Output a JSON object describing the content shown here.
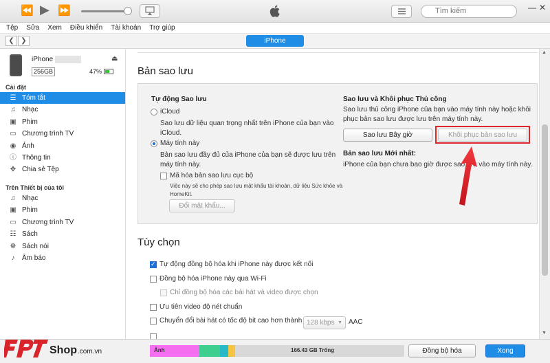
{
  "toolbar": {
    "prev_icon": "rewind-icon",
    "play_icon": "play-icon",
    "next_icon": "fast-forward-icon",
    "search_placeholder": "Tìm kiếm"
  },
  "menu": [
    "Tệp",
    "Sửa",
    "Xem",
    "Điều khiển",
    "Tài khoản",
    "Trợ giúp"
  ],
  "nav": {
    "device_tab": "iPhone"
  },
  "device": {
    "name": "iPhone",
    "capacity": "256GB",
    "battery": "47%",
    "battery_level": 0.47
  },
  "sidebar": {
    "settings_heading": "Cài đặt",
    "settings_items": [
      {
        "label": "Tóm tắt",
        "icon": "list-icon",
        "selected": true
      },
      {
        "label": "Nhạc",
        "icon": "music-note-icon"
      },
      {
        "label": "Phim",
        "icon": "film-icon"
      },
      {
        "label": "Chương trình TV",
        "icon": "tv-icon"
      },
      {
        "label": "Ảnh",
        "icon": "camera-icon"
      },
      {
        "label": "Thông tin",
        "icon": "info-icon"
      },
      {
        "label": "Chia sẻ Tệp",
        "icon": "apps-icon"
      }
    ],
    "ondevice_heading": "Trên Thiết bị của tôi",
    "ondevice_items": [
      {
        "label": "Nhạc",
        "icon": "music-note-icon"
      },
      {
        "label": "Phim",
        "icon": "film-icon"
      },
      {
        "label": "Chương trình TV",
        "icon": "tv-icon"
      },
      {
        "label": "Sách",
        "icon": "book-icon"
      },
      {
        "label": "Sách nói",
        "icon": "audiobook-icon"
      },
      {
        "label": "Âm báo",
        "icon": "bell-icon"
      }
    ]
  },
  "backup": {
    "title": "Bản sao lưu",
    "auto_heading": "Tự động Sao lưu",
    "icloud_label": "iCloud",
    "icloud_desc_1": "Sao lưu dữ liệu quan trọng nhất trên iPhone của bạn vào",
    "icloud_desc_2": "iCloud.",
    "computer_label": "Máy tính này",
    "computer_desc_1": "Bản sao lưu đầy đủ của iPhone của bạn sẽ được lưu trên",
    "computer_desc_2": "máy tính này.",
    "encrypt_label": "Mã hóa bản sao lưu cục bộ",
    "encrypt_desc_1": "Việc này sẽ cho phép sao lưu mật khẩu tài khoản, dữ liệu Sức khỏe và",
    "encrypt_desc_2": "HomeKit.",
    "change_password_btn": "Đổi mật khẩu...",
    "manual_heading": "Sao lưu và Khôi phục Thủ công",
    "manual_desc_1": "Sao lưu thủ công iPhone của bạn vào máy tính này hoặc khôi",
    "manual_desc_2": "phục bản sao lưu được lưu trên máy tính này.",
    "backup_now_btn": "Sao lưu Bây giờ",
    "restore_btn": "Khôi phục bản sao lưu",
    "latest_heading": "Bản sao lưu Mới nhất:",
    "latest_desc": "iPhone của bạn chưa bao giờ được sao lưu vào máy tính này."
  },
  "options": {
    "title": "Tùy chọn",
    "items": [
      {
        "label": "Tự động đồng bộ hóa khi iPhone này được kết nối",
        "checked": true
      },
      {
        "label": "Đồng bộ hóa iPhone này qua Wi-Fi",
        "checked": false
      },
      {
        "label": "Chỉ đồng bộ hóa các bài hát và video được chọn",
        "checked": false,
        "disabled": true
      },
      {
        "label": "Ưu tiên video độ nét chuẩn",
        "checked": false
      },
      {
        "label": "Chuyển đổi bài hát có tốc độ bit cao hơn thành",
        "checked": false
      }
    ],
    "bitrate_value": "128 kbps",
    "bitrate_unit": "AAC"
  },
  "storage": {
    "photos_label": "Ảnh",
    "free_label": "166.43 GB Trống",
    "colors": {
      "photos": "#f56ef0",
      "apps": "#3ecf8e",
      "other1": "#28b9c9",
      "other2": "#f5c542",
      "free": "#d9d9d9"
    }
  },
  "bottom": {
    "sync_btn": "Đồng bộ hóa",
    "done_btn": "Xong"
  },
  "branding": {
    "logo_text": "FPT",
    "shop_text": "Shop",
    "domain_text": ".com.vn"
  }
}
